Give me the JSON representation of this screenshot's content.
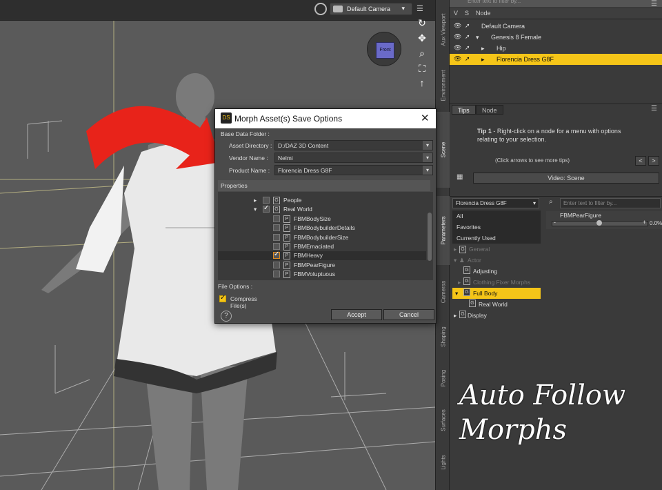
{
  "viewport": {
    "camera": "Default Camera",
    "cube_face": "Front"
  },
  "side_tabs": [
    "Aux Viewport",
    "Environment",
    "Scene",
    "Parameters",
    "Cameras",
    "Shaping",
    "Posing",
    "Surfaces",
    "Lights"
  ],
  "scene": {
    "filter_placeholder": "Enter text to filter by...",
    "col_v": "V",
    "col_s": "S",
    "col_node": "Node",
    "nodes": [
      "Default Camera",
      "Genesis 8 Female",
      "Hip",
      "Florencia Dress G8F"
    ]
  },
  "tips": {
    "tab_tips": "Tips",
    "tab_node": "Node",
    "tip_title": "Tip 1",
    "tip_body": " - Right-click on a node for a menu with options relating to your selection.",
    "nav": "(Click arrows to see more tips)",
    "prev": "<",
    "next": ">",
    "video": "Video: Scene"
  },
  "params": {
    "node": "Florencia Dress G8F",
    "filter_placeholder": "Enter text to filter by...",
    "list": [
      "All",
      "Favorites",
      "Currently Used",
      "General",
      "Actor",
      "Adjusting",
      "Clothing Fixer Morphs",
      "Full Body",
      "Real World",
      "Display"
    ],
    "slider_label": "FBMPearFigure",
    "slider_value": "0.0%"
  },
  "dialog": {
    "title": "Morph Asset(s) Save Options",
    "logo": "DS",
    "base_folder": "Base Data Folder :",
    "asset_dir_label": "Asset Directory :",
    "asset_dir": "D:/DAZ 3D Content",
    "vendor_label": "Vendor Name :",
    "vendor": "Nelmi",
    "product_label": "Product Name :",
    "product": "Florencia Dress G8F",
    "properties": "Properties",
    "items": [
      "People",
      "Real World",
      "FBMBodySize",
      "FBMBodybuilderDetails",
      "FBMBodybuilderSize",
      "FBMEmaciated",
      "FBMHeavy",
      "FBMPearFigure",
      "FBMVoluptuous"
    ],
    "file_options": "File Options :",
    "compress": "Compress File(s)",
    "accept": "Accept",
    "cancel": "Cancel",
    "help": "?"
  },
  "overlay": {
    "line1": "Auto Follow",
    "line2": "Morphs"
  },
  "colors": {
    "accent": "#f5c518",
    "arrow": "#e8231a"
  }
}
